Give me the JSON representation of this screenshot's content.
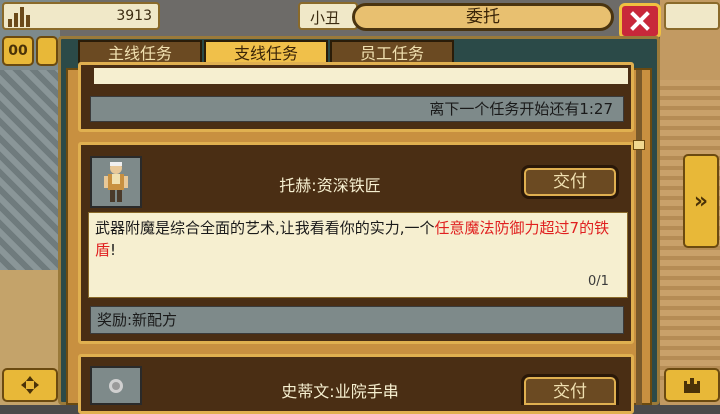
{
  "top_bar": {
    "coins": "3913",
    "player_name": "小丑",
    "window_title": "委托"
  },
  "side_buttons": {
    "left_top": "00",
    "right_arrow": "»"
  },
  "tabs": [
    {
      "label": "主线任务",
      "active": false
    },
    {
      "label": "支线任务",
      "active": true
    },
    {
      "label": "员工任务",
      "active": false
    }
  ],
  "quest_list": {
    "timer_text": "离下一个任务开始还有1:27",
    "quests": [
      {
        "npc": "托赫:资深铁匠",
        "action": "交付",
        "description_plain": "武器附魔是综合全面的艺术,让我看看你的实力,一个",
        "description_highlight": "任意魔法防御力超过7的铁盾",
        "description_end": "!",
        "progress": "0/1",
        "reward": "奖励:新配方"
      },
      {
        "npc": "史蒂文:业院手串",
        "action": "交付"
      }
    ]
  },
  "colors": {
    "highlight": "#e02020",
    "accent_gold": "#e0b050",
    "close_red": "#c8283a"
  }
}
